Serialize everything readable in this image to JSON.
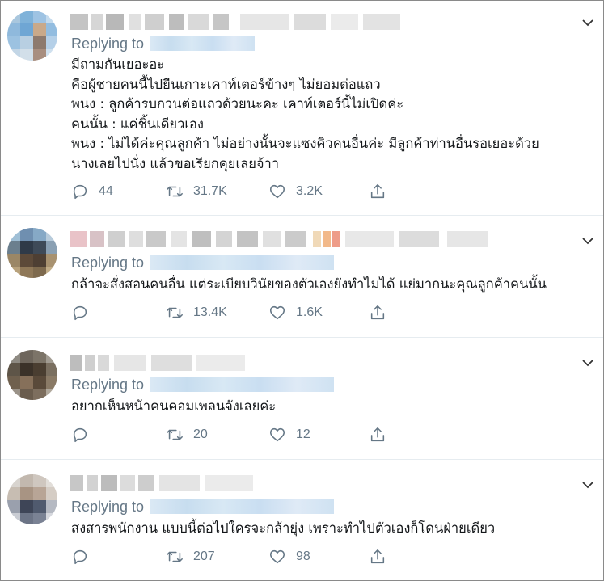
{
  "tweets": [
    {
      "reply_prefix": "Replying to",
      "lines": [
        "มีถามกันเยอะอะ",
        "คือผู้ชายคนนี้ไปยืนเกาะเคาท์เตอร์ข้างๆ ไม่ยอมต่อแถว",
        "พนง : ลูกค้ารบกวนต่อแถวด้วยนะคะ เคาท์เตอร์นี้ไม่เปิดค่ะ",
        "คนนั้น : แค่ชิ้นเดียวเอง",
        "พนง : ไม่ได้ค่ะคุณลูกค้า ไม่อย่างนั้นจะแซงคิวคนอื่นค่ะ มีลูกค้าท่านอื่นรอเยอะด้วย",
        "นางเลยไปนั่ง แล้วขอเรียกคุยเลยจ้าา"
      ],
      "replies": "44",
      "retweets": "31.7K",
      "likes": "3.2K"
    },
    {
      "reply_prefix": "Replying to",
      "lines": [
        "กล้าจะสั่งสอนคนอื่น แต่ระเบียบวินัยของตัวเองยังทำไม่ได้ แย่มากนะคุณลูกค้าคนนั้น"
      ],
      "replies": "",
      "retweets": "13.4K",
      "likes": "1.6K"
    },
    {
      "reply_prefix": "Replying to",
      "lines": [
        "อยากเห็นหน้าคนคอมเพลนจังเลยค่ะ"
      ],
      "replies": "",
      "retweets": "20",
      "likes": "12"
    },
    {
      "reply_prefix": "Replying to",
      "lines": [
        "สงสารพนักงาน แบบนี้ต่อไปใครจะกล้ายุ่ง เพราะทำไปตัวเองก็โดนฝ่ายเดียว"
      ],
      "replies": "",
      "retweets": "207",
      "likes": "98"
    }
  ],
  "colors": {
    "text": "#14171a",
    "muted": "#657786",
    "divider": "#e6ecf0"
  },
  "icons": [
    "reply-icon",
    "retweet-icon",
    "like-icon",
    "share-icon",
    "chevron-down-icon"
  ]
}
